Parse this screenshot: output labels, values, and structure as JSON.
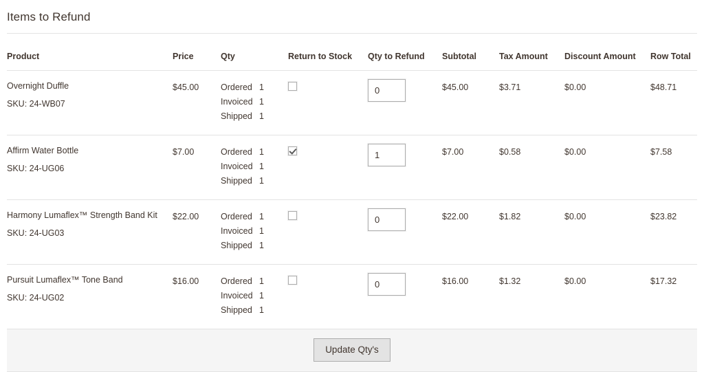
{
  "section": {
    "title": "Items to Refund"
  },
  "table": {
    "headers": {
      "product": "Product",
      "price": "Price",
      "qty": "Qty",
      "return_to_stock": "Return to Stock",
      "qty_to_refund": "Qty to Refund",
      "subtotal": "Subtotal",
      "tax_amount": "Tax Amount",
      "discount_amount": "Discount Amount",
      "row_total": "Row Total"
    },
    "qty_labels": {
      "ordered": "Ordered",
      "invoiced": "Invoiced",
      "shipped": "Shipped"
    },
    "rows": [
      {
        "product_name": "Overnight Duffle",
        "sku": "SKU: 24-WB07",
        "price": "$45.00",
        "ordered": "1",
        "invoiced": "1",
        "shipped": "1",
        "return_to_stock": false,
        "qty_to_refund": "0",
        "subtotal": "$45.00",
        "tax_amount": "$3.71",
        "discount_amount": "$0.00",
        "row_total": "$48.71"
      },
      {
        "product_name": "Affirm Water Bottle",
        "sku": "SKU: 24-UG06",
        "price": "$7.00",
        "ordered": "1",
        "invoiced": "1",
        "shipped": "1",
        "return_to_stock": true,
        "qty_to_refund": "1",
        "subtotal": "$7.00",
        "tax_amount": "$0.58",
        "discount_amount": "$0.00",
        "row_total": "$7.58"
      },
      {
        "product_name": "Harmony Lumaflex™ Strength Band Kit",
        "sku": "SKU: 24-UG03",
        "price": "$22.00",
        "ordered": "1",
        "invoiced": "1",
        "shipped": "1",
        "return_to_stock": false,
        "qty_to_refund": "0",
        "subtotal": "$22.00",
        "tax_amount": "$1.82",
        "discount_amount": "$0.00",
        "row_total": "$23.82"
      },
      {
        "product_name": "Pursuit Lumaflex™ Tone Band",
        "sku": "SKU: 24-UG02",
        "price": "$16.00",
        "ordered": "1",
        "invoiced": "1",
        "shipped": "1",
        "return_to_stock": false,
        "qty_to_refund": "0",
        "subtotal": "$16.00",
        "tax_amount": "$1.32",
        "discount_amount": "$0.00",
        "row_total": "$17.32"
      }
    ]
  },
  "footer": {
    "update_button_label": "Update Qty's"
  },
  "colors": {
    "text": "#41362f",
    "rule": "#e3e3e3",
    "footer_bg": "#f5f5f5",
    "button_bg": "#e3e3e3",
    "button_border": "#adadad"
  }
}
